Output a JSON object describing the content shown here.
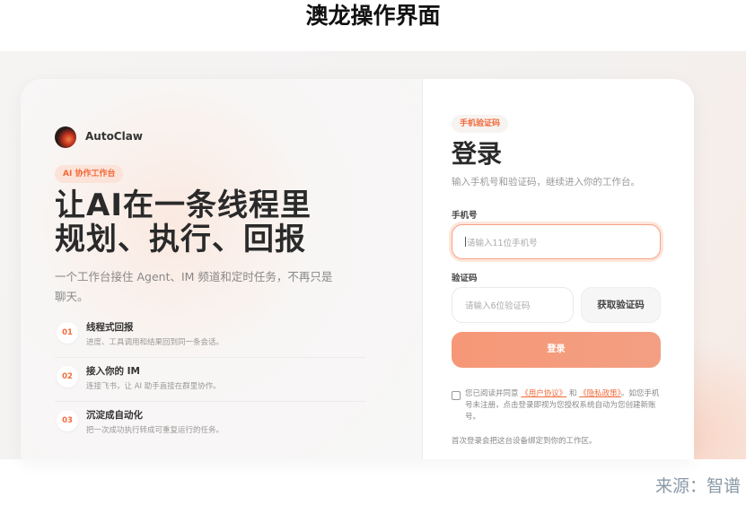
{
  "page_title": "澳龙操作界面",
  "source": "来源：智谱",
  "brand": {
    "name": "AutoClaw",
    "logo_icon": "autoclaw-logo"
  },
  "left": {
    "badge": "AI 协作工作台",
    "headline_line1": "让AI在一条线程里",
    "headline_line2": "规划、执行、回报",
    "subtitle": "一个工作台接住 Agent、IM 频道和定时任务，不再只是聊天。",
    "features": [
      {
        "num": "01",
        "title": "线程式回报",
        "desc": "进度、工具调用和结果回到同一条会话。"
      },
      {
        "num": "02",
        "title": "接入你的 IM",
        "desc": "连接飞书，让 AI 助手直接在群里协作。"
      },
      {
        "num": "03",
        "title": "沉淀成自动化",
        "desc": "把一次成功执行转成可重复运行的任务。"
      }
    ]
  },
  "login": {
    "badge": "手机验证码",
    "title": "登录",
    "subtitle": "输入手机号和验证码，继续进入你的工作台。",
    "phone_label": "手机号",
    "phone_placeholder": "请输入11位手机号",
    "code_label": "验证码",
    "code_placeholder": "请输入6位验证码",
    "get_code": "获取验证码",
    "submit": "登录",
    "terms_pre": "您已阅读并同意",
    "terms_user": "《用户协议》",
    "terms_and": "和",
    "terms_privacy": "《隐私政策》",
    "terms_post": "。如您手机号未注册，点击登录即视为您授权系统自动为您创建新账号。",
    "note": "首次登录会把这台设备绑定到你的工作区。"
  },
  "colors": {
    "accent": "#f26a3a",
    "button": "#f69877"
  }
}
